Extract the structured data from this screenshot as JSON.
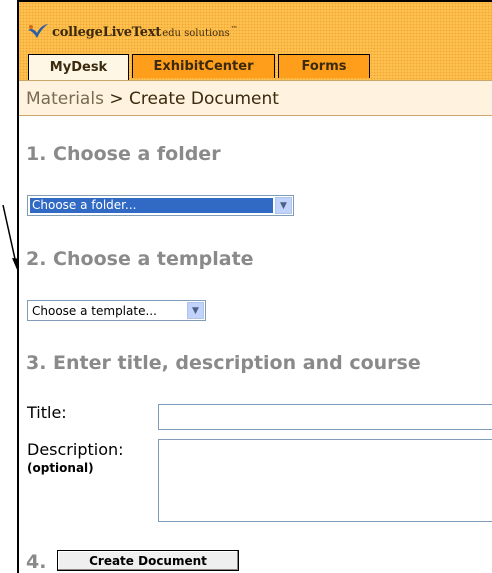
{
  "logo": {
    "main": "collegeLiveText",
    "sub": "edu solutions",
    "tm": "™"
  },
  "tabs": [
    {
      "label": "MyDesk"
    },
    {
      "label": "ExhibitCenter"
    },
    {
      "label": "Forms"
    }
  ],
  "breadcrumb": {
    "parent": "Materials",
    "separator": " > ",
    "current": "Create Document"
  },
  "steps": {
    "step1": "1. Choose a folder",
    "step2": "2. Choose a template",
    "step3": "3. Enter title, description and course",
    "step4": "4."
  },
  "folder_select": {
    "value": "Choose a folder..."
  },
  "template_select": {
    "value": "Choose a template..."
  },
  "form": {
    "title_label": "Title:",
    "title_value": "",
    "description_label": "Description:",
    "description_note": "(optional)",
    "description_value": ""
  },
  "create_button": {
    "label": "Create Document"
  },
  "colors": {
    "header_bg": "#ffc24f",
    "tab_orange": "#ff9e1a",
    "crumb_bg": "#fff3df",
    "step_text": "#8a8a8a",
    "select_highlight": "#316ac5"
  }
}
